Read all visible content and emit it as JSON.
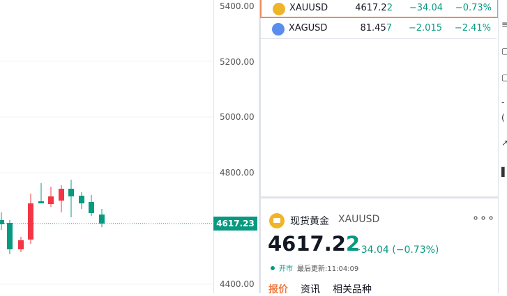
{
  "price_axis": {
    "labels": [
      "5400.00",
      "5200.00",
      "5000.00",
      "4800.00",
      "4400.00"
    ],
    "current_tag": "4617.23"
  },
  "watchlist": {
    "rows": [
      {
        "symbol": "XAUUSD",
        "last_main": "4617.2",
        "last_tail": "2",
        "change": "−34.04",
        "pct": "−0.73%",
        "selected": true,
        "icon": "gold-icon"
      },
      {
        "symbol": "XAGUSD",
        "last_main": "81.45",
        "last_tail": "7",
        "change": "−2.015",
        "pct": "−2.41%",
        "selected": false,
        "icon": "silver-icon"
      }
    ]
  },
  "detail": {
    "name": "现货黄金",
    "symbol": "XAUUSD",
    "more": "∘∘∘",
    "price_main": "4617.2",
    "price_tail": "2",
    "change": "−34.04 (−0.73%)",
    "market_status": "开市",
    "last_update": "最后更新:11:04:09",
    "tabs": {
      "quote": "报价",
      "news": "资讯",
      "related": "相关品种"
    }
  },
  "colors": {
    "up": "#f23645",
    "down": "#089981",
    "accent": "#f07b3f"
  }
}
